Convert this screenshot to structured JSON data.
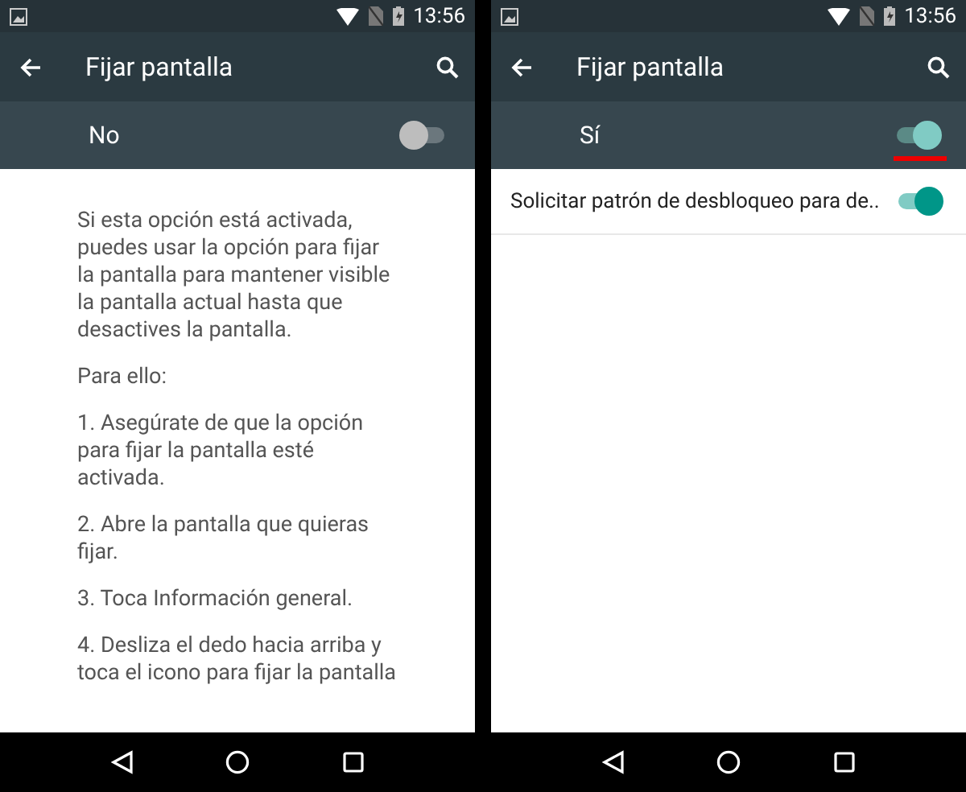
{
  "screens": [
    {
      "status_bar": {
        "time": "13:56"
      },
      "toolbar": {
        "title": "Fijar pantalla"
      },
      "master_switch": {
        "label": "No",
        "on": false,
        "highlighted": false
      },
      "description": [
        "Si esta opción está activada, puedes usar la opción para fijar la pantalla para mantener visible la pantalla actual hasta que desactives la pantalla.",
        "Para ello:",
        "1. Asegúrate de que la opción para fijar la pantalla esté activada.",
        "2. Abre la pantalla que quieras fijar.",
        "3. Toca Información general.",
        "4. Desliza el dedo hacia arriba y toca el icono para fijar la pantalla"
      ]
    },
    {
      "status_bar": {
        "time": "13:56"
      },
      "toolbar": {
        "title": "Fijar pantalla"
      },
      "master_switch": {
        "label": "Sí",
        "on": true,
        "highlighted": true
      },
      "settings": [
        {
          "label": "Solicitar patrón de desbloqueo para de..",
          "on": true
        }
      ]
    }
  ]
}
